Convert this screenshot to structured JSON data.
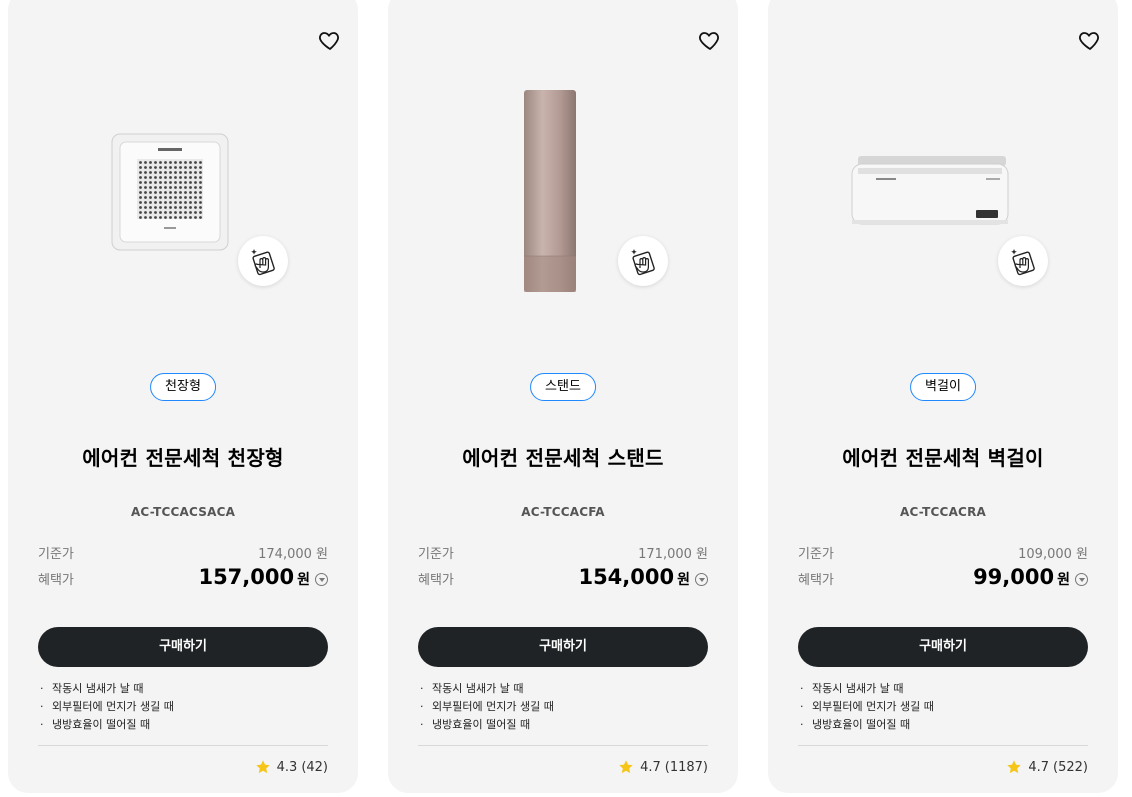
{
  "cards": [
    {
      "tag": "천장형",
      "title": "에어컨 전문세척 천장형",
      "model": "AC-TCCACSACA",
      "base_label": "기준가",
      "base_price": "174,000 원",
      "benefit_label": "혜택가",
      "benefit_price": "157,000",
      "currency": "원",
      "buy_label": "구매하기",
      "bullets": [
        "작동시 냄새가 날 때",
        "외부필터에 먼지가 생길 때",
        "냉방효율이 떨어질 때"
      ],
      "rating": "4.3",
      "review_count": "(42)",
      "image_icon": "ceiling-cassette-ac-image",
      "badge_icon": "cleaning-hand-icon"
    },
    {
      "tag": "스탠드",
      "title": "에어컨 전문세척 스탠드",
      "model": "AC-TCCACFA",
      "base_label": "기준가",
      "base_price": "171,000 원",
      "benefit_label": "혜택가",
      "benefit_price": "154,000",
      "currency": "원",
      "buy_label": "구매하기",
      "bullets": [
        "작동시 냄새가 날 때",
        "외부필터에 먼지가 생길 때",
        "냉방효율이 떨어질 때"
      ],
      "rating": "4.7",
      "review_count": "(1187)",
      "image_icon": "stand-ac-image",
      "badge_icon": "cleaning-hand-icon"
    },
    {
      "tag": "벽걸이",
      "title": "에어컨 전문세척 벽걸이",
      "model": "AC-TCCACRA",
      "base_label": "기준가",
      "base_price": "109,000 원",
      "benefit_label": "혜택가",
      "benefit_price": "99,000",
      "currency": "원",
      "buy_label": "구매하기",
      "bullets": [
        "작동시 냄새가 날 때",
        "외부필터에 먼지가 생길 때",
        "냉방효율이 떨어질 때"
      ],
      "rating": "4.7",
      "review_count": "(522)",
      "image_icon": "wall-mounted-ac-image",
      "badge_icon": "cleaning-hand-icon"
    }
  ],
  "colors": {
    "card_bg": "#f4f4f4",
    "tag_border": "#2189ff",
    "button_bg": "#202325",
    "star": "#f5c518"
  }
}
